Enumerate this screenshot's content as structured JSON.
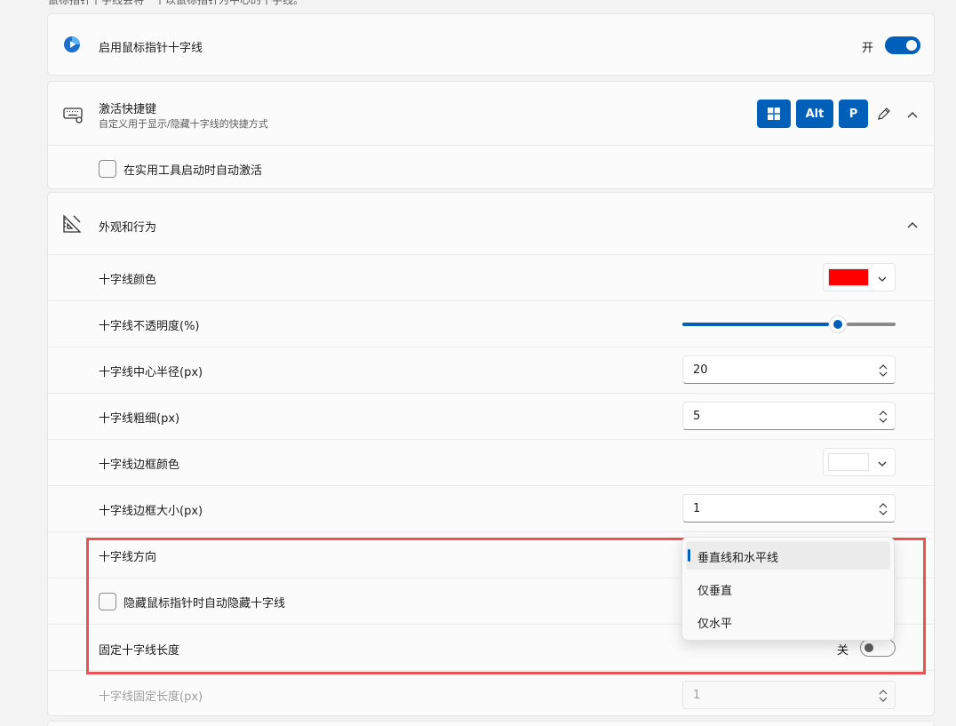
{
  "header_cut_text": "鼠标指针十字线会将一个以鼠标指针为中心的十字线。",
  "enable_card": {
    "title": "启用鼠标指针十字线",
    "toggle_label": "开",
    "enabled": true
  },
  "shortcut_card": {
    "title": "激活快捷键",
    "subtitle": "自定义用于显示/隐藏十字线的快捷方式",
    "keys": [
      "Win",
      "Alt",
      "P"
    ],
    "auto_activate_label": "在实用工具启动时自动激活",
    "auto_activate_checked": false
  },
  "appearance_card": {
    "title": "外观和行为",
    "color_label": "十字线颜色",
    "color_value": "#ff0000",
    "opacity_label": "十字线不透明度(%)",
    "opacity_fraction": 0.73,
    "radius_label": "十字线中心半径(px)",
    "radius_value": "20",
    "thickness_label": "十字线粗细(px)",
    "thickness_value": "5",
    "border_color_label": "十字线边框颜色",
    "border_color_value": "#ffffff",
    "border_size_label": "十字线边框大小(px)",
    "border_size_value": "1",
    "orientation_label": "十字线方向",
    "orientation_options": [
      "垂直线和水平线",
      "仅垂直",
      "仅水平"
    ],
    "orientation_selected": 0,
    "auto_hide_label": "隐藏鼠标指针时自动隐藏十字线",
    "fixed_length_label": "固定十字线长度",
    "fixed_length_toggle_label": "关",
    "fixed_length_enabled": false,
    "fixed_length_value_label": "十字线固定长度(px)",
    "fixed_length_value": "1"
  },
  "colors": {
    "accent": "#005fb8",
    "highlight_border": "#e8535a"
  }
}
